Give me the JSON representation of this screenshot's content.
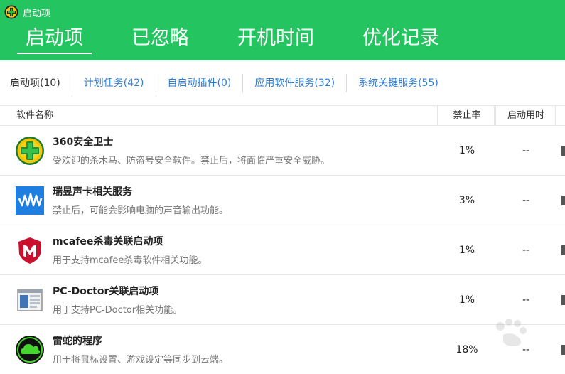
{
  "window": {
    "title": "启动项",
    "logo_icon": "360-logo-icon"
  },
  "main_tabs": [
    {
      "label": "启动项",
      "active": true
    },
    {
      "label": "已忽略",
      "active": false
    },
    {
      "label": "开机时间",
      "active": false
    },
    {
      "label": "优化记录",
      "active": false
    }
  ],
  "sub_tabs": [
    {
      "label": "启动项(10)"
    },
    {
      "label": "计划任务(42)"
    },
    {
      "label": "自启动插件(0)"
    },
    {
      "label": "应用软件服务(32)"
    },
    {
      "label": "系统关键服务(55)"
    }
  ],
  "table": {
    "headers": {
      "name": "软件名称",
      "rate": "禁止率",
      "time": "启动用时"
    },
    "rows": [
      {
        "title": "360安全卫士",
        "desc": "受欢迎的杀木马、防盗号安全软件。禁止后，将面临严重安全威胁。",
        "rate": "1%",
        "time": "--",
        "icon": "360-shield-icon"
      },
      {
        "title": "瑞昱声卡相关服务",
        "desc": "禁止后，可能会影响电脑的声音输出功能。",
        "rate": "3%",
        "time": "--",
        "icon": "audio-wave-icon"
      },
      {
        "title": "mcafee杀毒关联启动项",
        "desc": "用于支持mcafee杀毒软件相关功能。",
        "rate": "1%",
        "time": "--",
        "icon": "mcafee-shield-icon"
      },
      {
        "title": "PC-Doctor关联启动项",
        "desc": "用于支持PC-Doctor相关功能。",
        "rate": "1%",
        "time": "--",
        "icon": "pc-doctor-window-icon"
      },
      {
        "title": "雷蛇的程序",
        "desc": "用于将鼠标设置、游戏设定等同步到云端。",
        "rate": "18%",
        "time": "--",
        "icon": "razer-cloud-icon"
      }
    ]
  },
  "colors": {
    "header_bg": "#24c560",
    "link": "#2f7fd8"
  }
}
